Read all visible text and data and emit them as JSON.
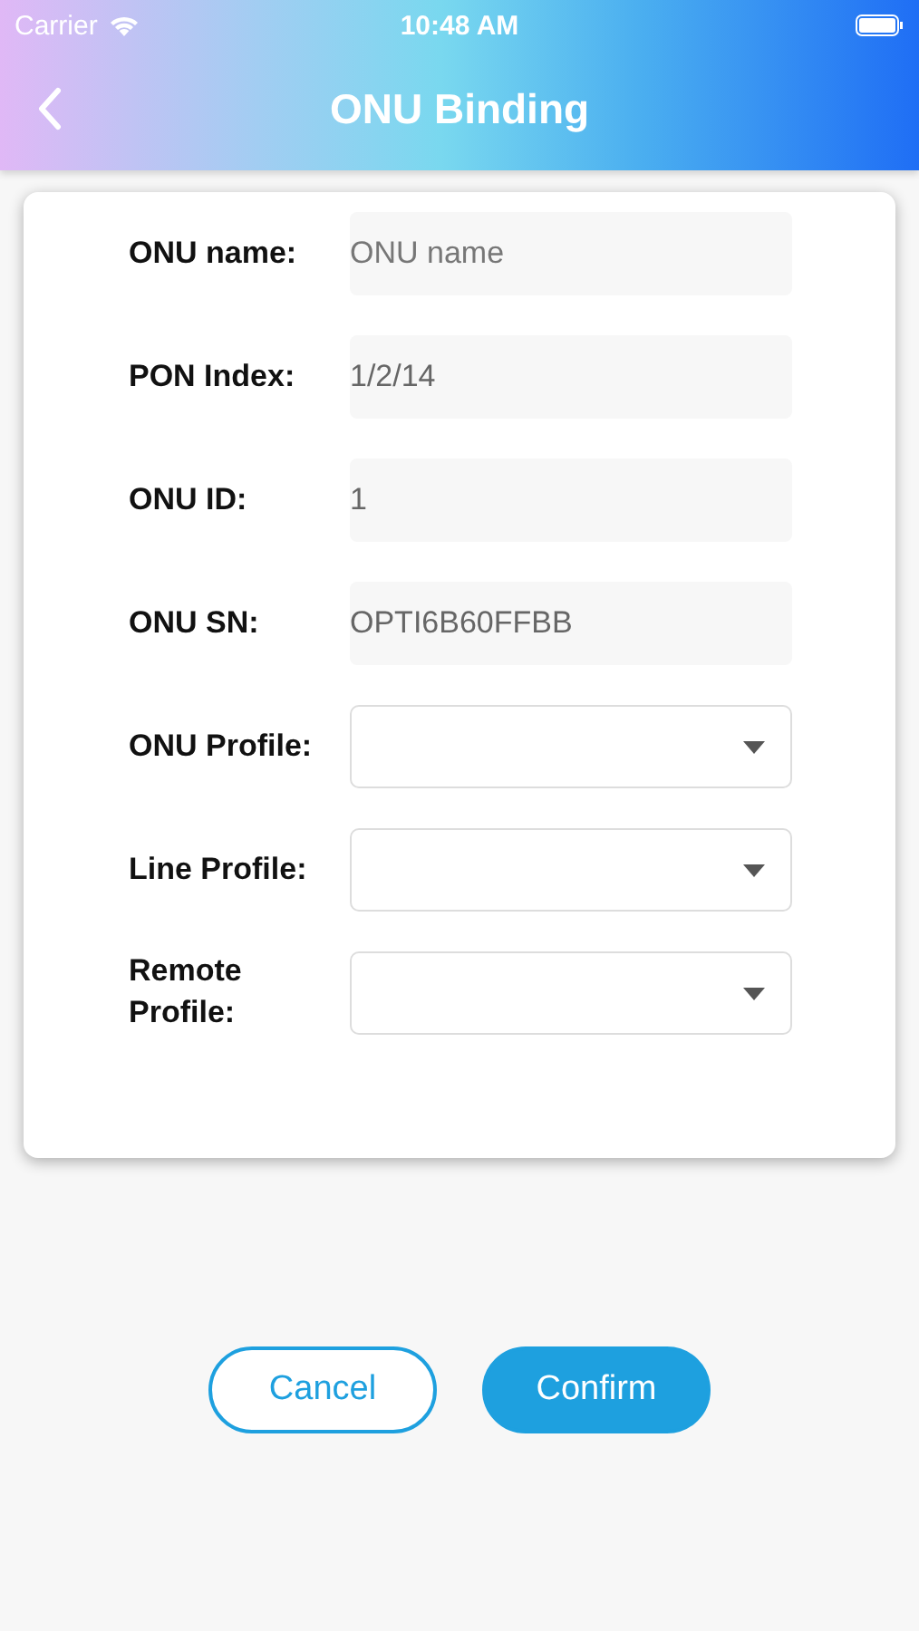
{
  "status_bar": {
    "carrier": "Carrier",
    "time": "10:48 AM"
  },
  "nav": {
    "title": "ONU Binding"
  },
  "fields": [
    {
      "label": "ONU name:",
      "kind": "text",
      "placeholder": "ONU name"
    },
    {
      "label": "PON Index:",
      "kind": "text",
      "value": "1/2/14"
    },
    {
      "label": "ONU ID:",
      "kind": "text",
      "value": "1"
    },
    {
      "label": "ONU SN:",
      "kind": "text",
      "value": "OPTI6B60FFBB"
    },
    {
      "label": "ONU Profile:",
      "kind": "select"
    },
    {
      "label": "Line Profile:",
      "kind": "select"
    },
    {
      "label": "Remote Profile:",
      "kind": "select"
    }
  ],
  "buttons": [
    {
      "label": "Cancel",
      "kind": "secondary"
    },
    {
      "label": "Confirm",
      "kind": "primary"
    }
  ]
}
